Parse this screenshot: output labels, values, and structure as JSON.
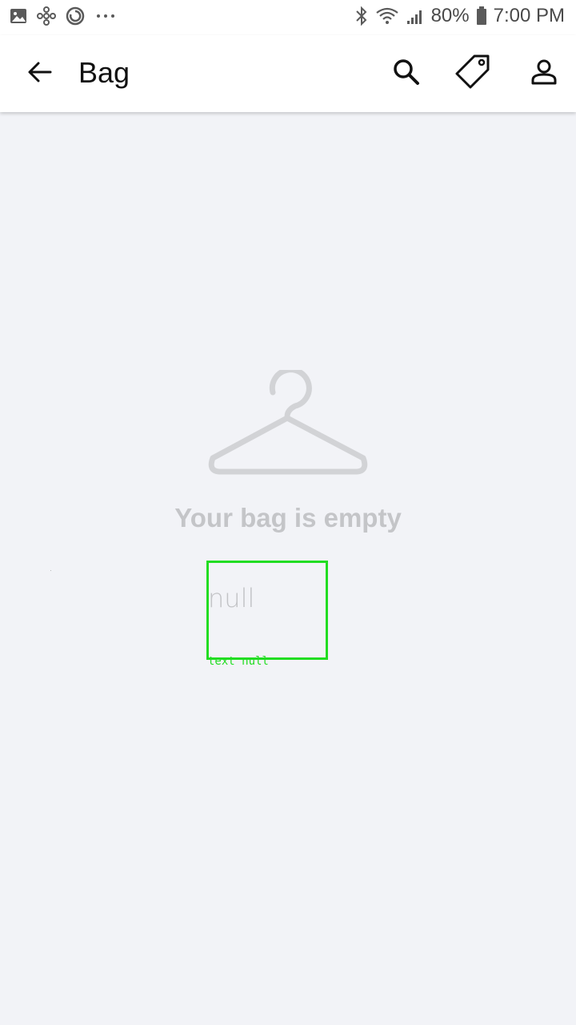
{
  "status_bar": {
    "battery": "80%",
    "time": "7:00 PM",
    "left_icons": [
      "gallery-icon",
      "pinwheel-icon",
      "sync-icon",
      "more-dots-icon"
    ],
    "right_icons": [
      "bluetooth-icon",
      "wifi-icon",
      "signal-icon",
      "battery-icon"
    ]
  },
  "app_bar": {
    "title": "Bag",
    "icons": [
      "back-arrow-icon",
      "search-icon",
      "tag-icon",
      "account-icon"
    ]
  },
  "empty_state": {
    "icon": "hanger-icon",
    "message": "Your bag is empty",
    "subtext": "null"
  },
  "debug_overlay": {
    "label": "text null",
    "color": "#22dd22"
  },
  "colors": {
    "background": "#f2f3f7",
    "app_bar": "#ffffff",
    "muted_text": "#c4c5c8"
  }
}
